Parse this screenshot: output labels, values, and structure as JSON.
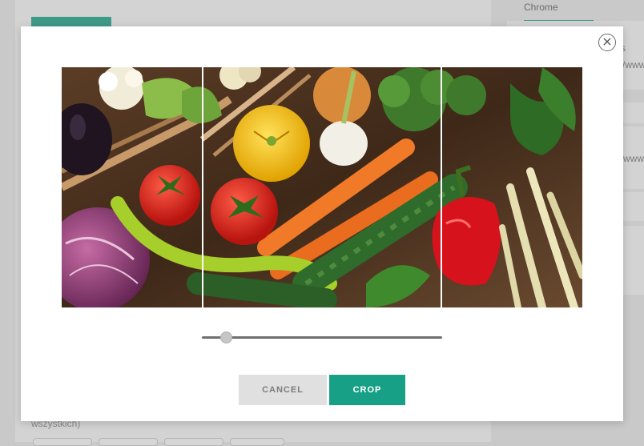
{
  "background": {
    "chrome_label": "Chrome",
    "card_partial_texts": [
      "s",
      "/www",
      "www"
    ],
    "bottom_label": "wszystkich)"
  },
  "modal": {
    "close_icon": "close-circle-icon",
    "image_alt": "Fresh vegetables: cauliflower, eggplant, red cabbage, tomatoes, green pepper, yellow squash, garlic, carrots, zucchini, broccoli, red bell pepper, parsley, green beans",
    "zoom_slider": {
      "value": 0.08
    },
    "buttons": {
      "cancel_label": "CANCEL",
      "crop_label": "CROP"
    }
  },
  "colors": {
    "accent": "#17a085",
    "cancel_bg": "#e0e0e0",
    "overlay": "#c9c9c9"
  }
}
